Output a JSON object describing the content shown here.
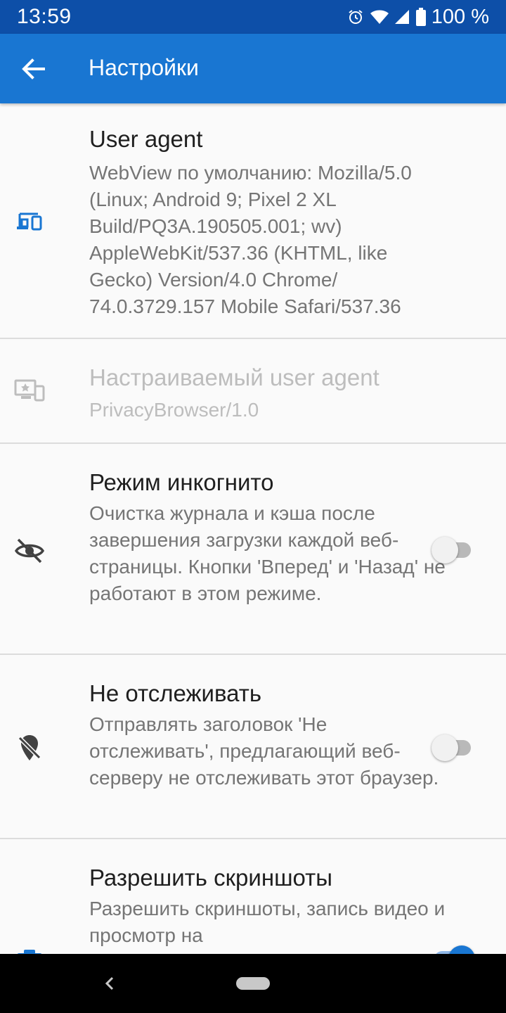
{
  "status_bar": {
    "time": "13:59",
    "battery": "100 %",
    "icons": [
      "alarm-icon",
      "wifi-icon",
      "signal-icon",
      "battery-icon"
    ]
  },
  "app_bar": {
    "title": "Настройки",
    "back_icon": "arrow-back-icon",
    "color": "#1976d2"
  },
  "preferences": [
    {
      "title": "User agent",
      "summary": "WebView по умолчанию: Mozilla/5.0 (Linux; Android 9; Pixel 2 XL Build/PQ3A.190505.001; wv) AppleWebKit/537.36 (KHTML, like Gecko) Version/4.0 Chrome/ 74.0.3729.157 Mobile Safari/537.36",
      "icon": "devices-icon",
      "enabled": true
    },
    {
      "title": "Настраиваемый user agent",
      "summary": "PrivacyBrowser/1.0",
      "icon": "custom-user-agent-icon",
      "enabled": false
    },
    {
      "title": "Режим инкогнито",
      "summary": "Очистка журнала и кэша после завершения загрузки каждой веб-страницы. Кнопки 'Вперед' и 'Назад' не работают в этом режиме.",
      "icon": "visibility-off-icon",
      "switch": false
    },
    {
      "title": "Не отслеживать",
      "summary": "Отправлять заголовок 'Не отслеживать', предлагающий веб-серверу не отслеживать этот браузер.",
      "icon": "location-off-icon",
      "switch": false
    },
    {
      "title": "Разрешить скриншоты",
      "summary": "Разрешить скриншоты, запись видео и просмотр на",
      "icon": "camera-icon",
      "switch": true
    }
  ],
  "nav_bar": {
    "back_icon": "nav-back-icon",
    "home_icon": "home-pill-icon"
  }
}
